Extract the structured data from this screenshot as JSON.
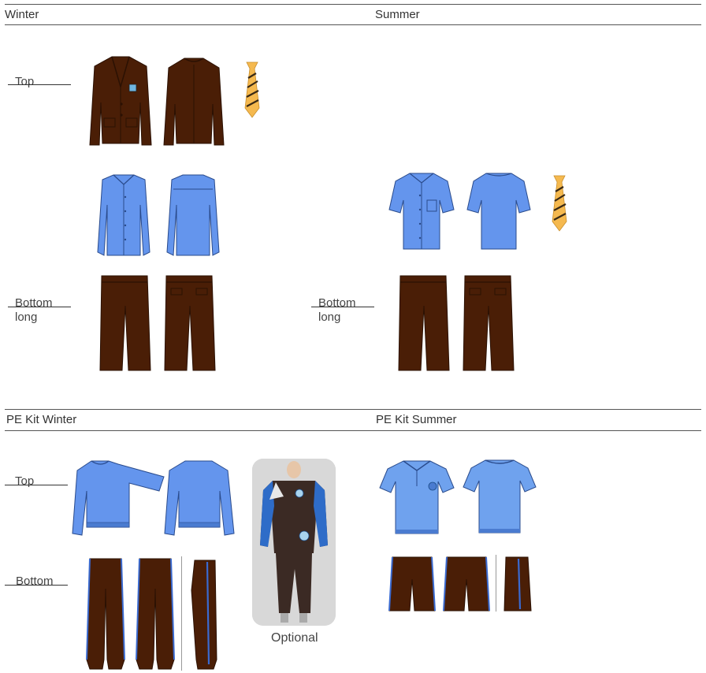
{
  "sections": {
    "winter": "Winter",
    "summer": "Summer",
    "pe_winter": "PE Kit Winter",
    "pe_summer": "PE Kit Summer"
  },
  "labels": {
    "top": "Top",
    "bottom": "Bottom",
    "long": "long",
    "pe_top": "Top",
    "pe_bottom": "Bottom",
    "optional": "Optional"
  },
  "colors": {
    "brown": "#4a1e06",
    "blue": "#6495ed",
    "light_blue": "#6fa2ee",
    "tie_gold": "#f5b94f",
    "tie_stripe": "#3a2a15"
  }
}
